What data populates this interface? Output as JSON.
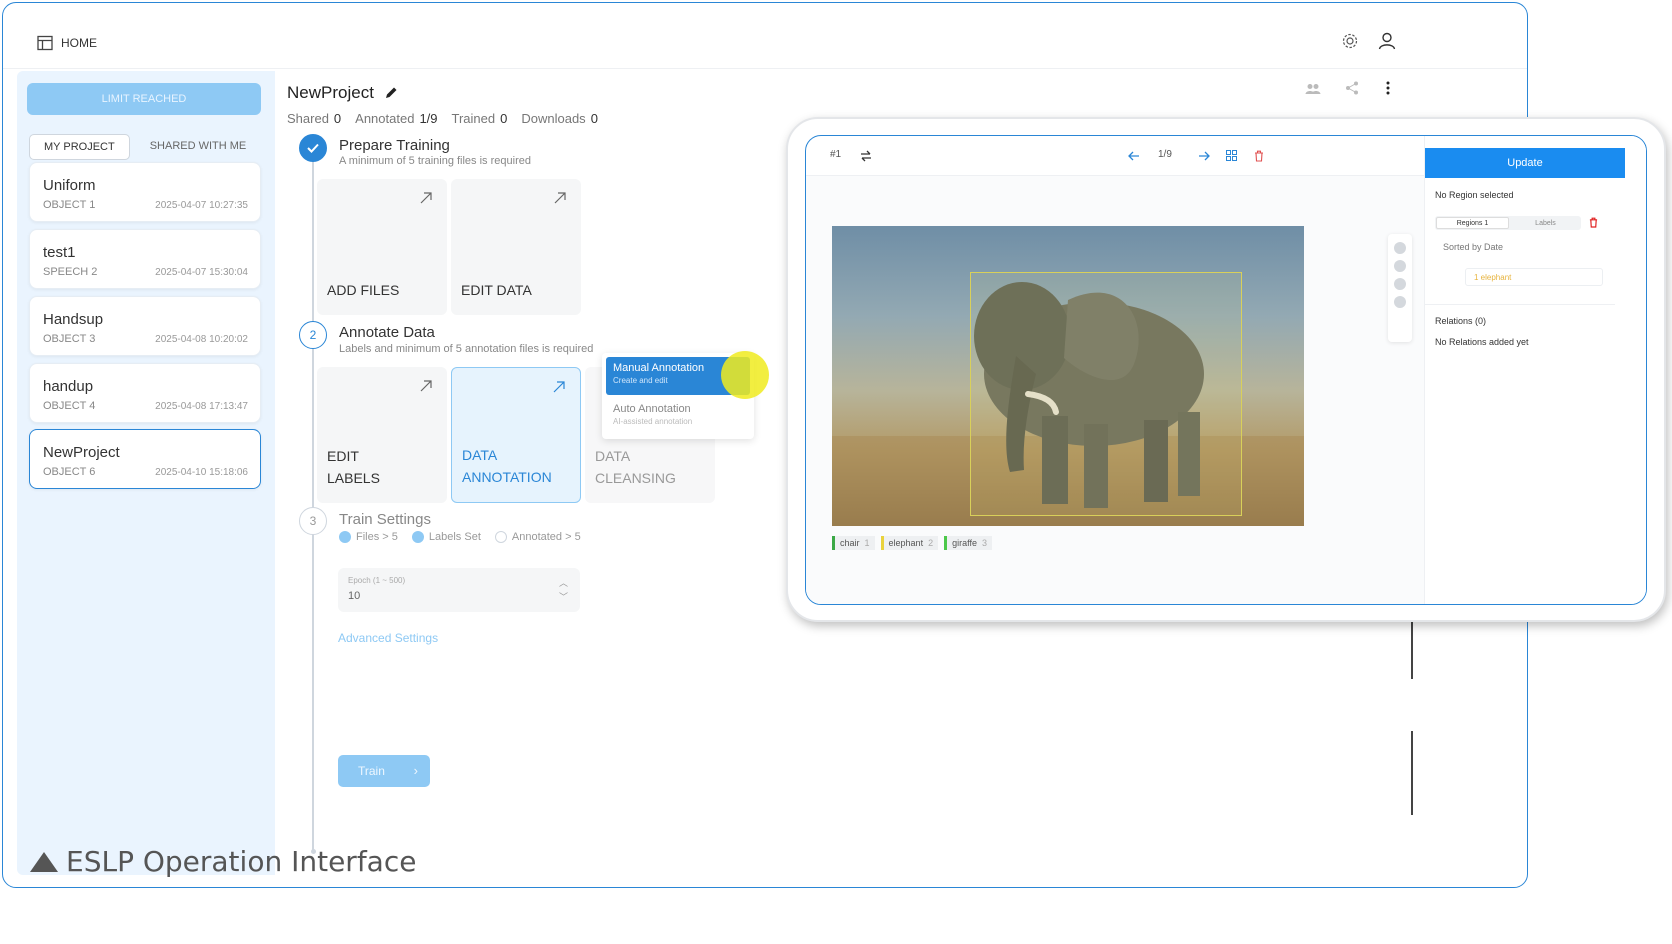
{
  "header": {
    "home_label": "HOME"
  },
  "sidebar": {
    "limit_label": "LIMIT REACHED",
    "tabs": [
      "MY PROJECT",
      "SHARED WITH ME"
    ],
    "projects": [
      {
        "name": "Uniform",
        "type": "OBJECT 1",
        "date": "2025-04-07 10:27:35"
      },
      {
        "name": "test1",
        "type": "SPEECH 2",
        "date": "2025-04-07 15:30:04"
      },
      {
        "name": "Handsup",
        "type": "OBJECT 3",
        "date": "2025-04-08 10:20:02"
      },
      {
        "name": "handup",
        "type": "OBJECT 4",
        "date": "2025-04-08 17:13:47"
      },
      {
        "name": "NewProject",
        "type": "OBJECT 6",
        "date": "2025-04-10 15:18:06"
      }
    ]
  },
  "project": {
    "title": "NewProject",
    "stats": [
      {
        "label": "Shared",
        "value": "0"
      },
      {
        "label": "Annotated",
        "value": "1/9"
      },
      {
        "label": "Trained",
        "value": "0"
      },
      {
        "label": "Downloads",
        "value": "0"
      }
    ]
  },
  "steps": {
    "prepare": {
      "num": "✓",
      "title": "Prepare Training",
      "subtitle": "A minimum of 5 training files is required",
      "cards": [
        "ADD FILES",
        "EDIT DATA"
      ]
    },
    "annotate": {
      "num": "2",
      "title": "Annotate Data",
      "subtitle": "Labels and minimum of 5 annotation files is required",
      "cards": [
        "EDIT\nLABELS",
        "DATA\nANNOTATION",
        "DATA\nCLEANSING"
      ]
    },
    "train": {
      "num": "3",
      "title": "Train Settings",
      "checks": [
        "Files > 5",
        "Labels Set",
        "Annotated > 5"
      ]
    }
  },
  "dropdown": {
    "manual_title": "Manual Annotation",
    "manual_sub": "Create and edit",
    "auto_title": "Auto Annotation",
    "auto_sub": "AI-assisted annotation"
  },
  "epoch": {
    "label": "Epoch (1 ~ 500)",
    "value": "10"
  },
  "advanced_label": "Advanced Settings",
  "train_label": "Train",
  "tablet": {
    "frame_label": "#1",
    "page_indicator": "1/9",
    "update_label": "Update",
    "no_region": "No Region selected",
    "seg_tabs": [
      "Regions 1",
      "Labels"
    ],
    "sorted_by": "Sorted by Date",
    "region_item": "1  elephant",
    "relations_title": "Relations (0)",
    "relations_empty": "No Relations added yet",
    "labels": [
      {
        "name": "chair",
        "count": "1",
        "color": "#3aa845"
      },
      {
        "name": "elephant",
        "count": "2",
        "color": "#e9d23c"
      },
      {
        "name": "giraffe",
        "count": "3",
        "color": "#4cc84a"
      }
    ]
  },
  "caption": "ESLP Operation Interface",
  "colors": {
    "accent": "#2a86d6",
    "accent_light": "#8ec9f4",
    "update": "#1a8cf0"
  }
}
